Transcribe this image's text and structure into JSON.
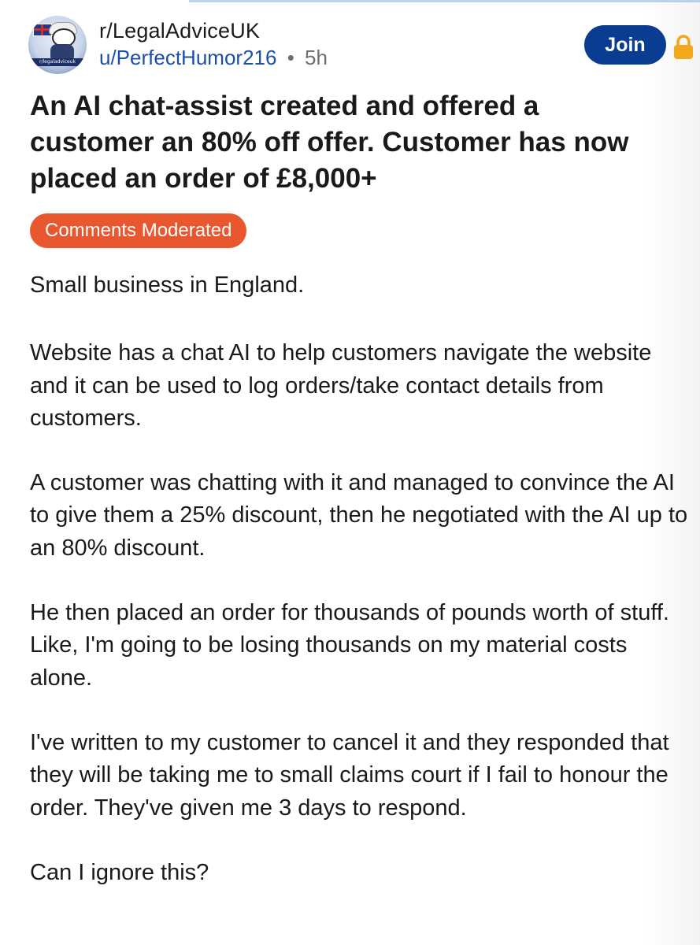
{
  "post": {
    "community": "r/LegalAdviceUK",
    "author": "u/PerfectHumor216",
    "separator": "•",
    "age": "5h",
    "join_label": "Join",
    "avatar_ribbon_text": "r/legaladviceuk",
    "title": "An AI chat-assist created and offered a customer an 80% off offer. Customer has now placed an order of £8,000+",
    "flair": "Comments Moderated",
    "paragraphs": [
      "Small business in England.",
      "Website has a chat AI to help customers navigate the website and it can be used to log orders/take contact details from customers.",
      "A customer was chatting with it and managed to convince the AI to give them a 25% discount, then he negotiated with the AI up to an 80% discount.",
      "He then placed an order for thousands of pounds worth of stuff. Like, I'm going to be losing thousands on my material costs alone.",
      "I've written to my customer to cancel it and they responded that they will be taking me to small claims court if I fail to honour the order. They've given me 3 days to respond.",
      "Can I ignore this?"
    ]
  },
  "icons": {
    "avatar": "community-avatar-icon",
    "lock": "lock-icon"
  },
  "colors": {
    "join_button": "#0a3d91",
    "flair_background": "#e8572e",
    "username": "#1c4fa8",
    "lock": "#f2a81d"
  }
}
